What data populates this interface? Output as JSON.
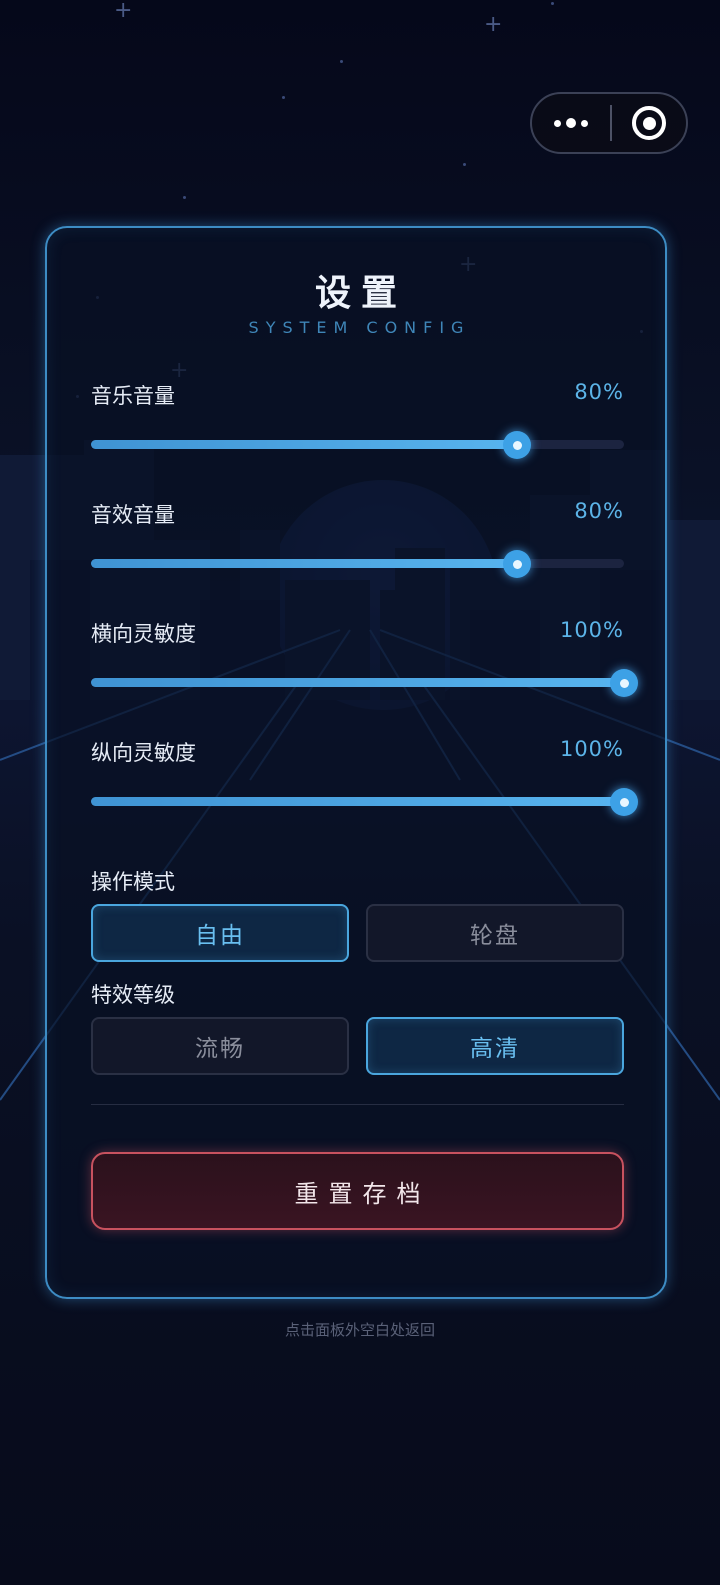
{
  "capsule": {
    "more_icon": "more-dots-icon",
    "close_icon": "target-icon"
  },
  "panel": {
    "title": "设置",
    "subtitle": "SYSTEM CONFIG"
  },
  "sliders": [
    {
      "label": "音乐音量",
      "value_text": "80%",
      "value": 80
    },
    {
      "label": "音效音量",
      "value_text": "80%",
      "value": 80
    },
    {
      "label": "横向灵敏度",
      "value_text": "100%",
      "value": 100
    },
    {
      "label": "纵向灵敏度",
      "value_text": "100%",
      "value": 100
    }
  ],
  "control_mode": {
    "label": "操作模式",
    "options": [
      "自由",
      "轮盘"
    ],
    "selected": "自由"
  },
  "effects_level": {
    "label": "特效等级",
    "options": [
      "流畅",
      "高清"
    ],
    "selected": "高清"
  },
  "reset_button": "重置存档",
  "hint": "点击面板外空白处返回",
  "colors": {
    "accent": "#4aa6de",
    "danger": "#c8525f",
    "background": "#060a18"
  }
}
